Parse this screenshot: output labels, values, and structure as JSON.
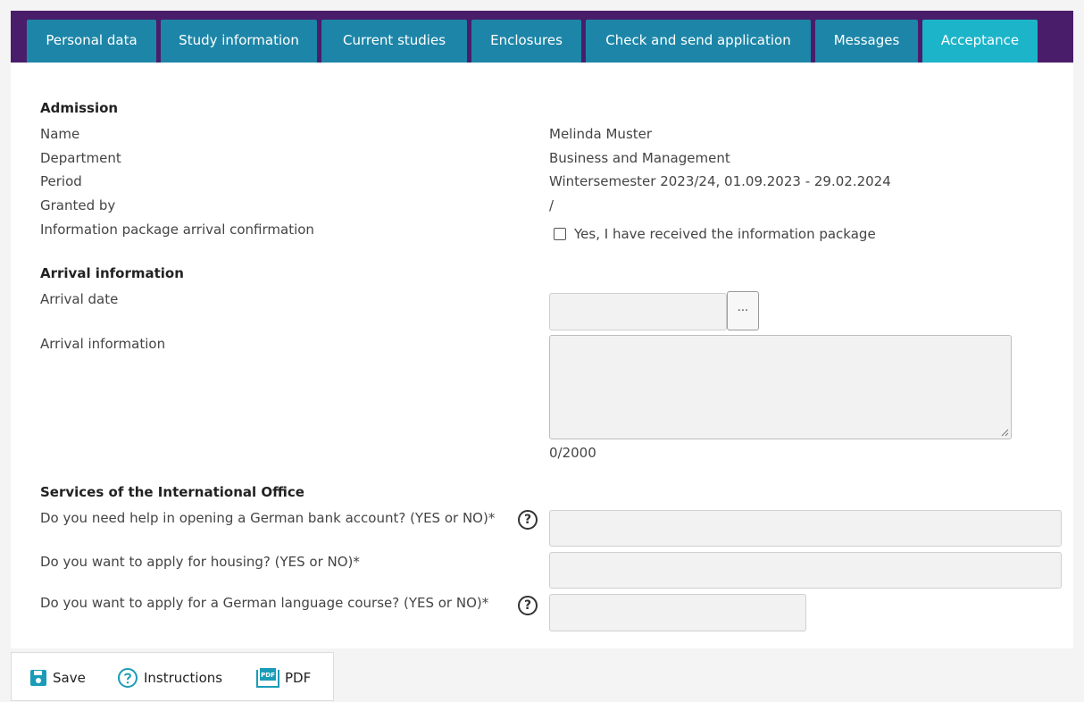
{
  "tabs": [
    {
      "label": "Personal data",
      "active": false
    },
    {
      "label": "Study information",
      "active": false
    },
    {
      "label": "Current studies",
      "active": false
    },
    {
      "label": "Enclosures",
      "active": false
    },
    {
      "label": "Check and send application",
      "active": false
    },
    {
      "label": "Messages",
      "active": false
    },
    {
      "label": "Acceptance",
      "active": true
    }
  ],
  "admission": {
    "title": "Admission",
    "name_label": "Name",
    "name_value": "Melinda Muster",
    "department_label": "Department",
    "department_value": "Business and Management",
    "period_label": "Period",
    "period_value": "Wintersemester 2023/24, 01.09.2023 - 29.02.2024",
    "granted_label": "Granted by",
    "granted_value": "/",
    "package_label": "Information package arrival confirmation",
    "package_checkbox_label": "Yes, I have received the information package",
    "package_checked": false
  },
  "arrival": {
    "title": "Arrival information",
    "date_label": "Arrival date",
    "date_value": "",
    "picker_label": "...",
    "info_label": "Arrival information",
    "info_value": "",
    "char_counter": "0/2000"
  },
  "services": {
    "title": "Services of the International Office",
    "bank_label": "Do you need help in opening a German bank account? (YES or NO)*",
    "bank_value": "",
    "housing_label": "Do you want to apply for housing? (YES or NO)*",
    "housing_value": "",
    "language_label": "Do you want to apply for a German language course? (YES or NO)*",
    "language_value": "",
    "help_glyph": "?"
  },
  "toolbar": {
    "save_label": "Save",
    "instructions_label": "Instructions",
    "pdf_label": "PDF",
    "pdf_badge": "PDF"
  },
  "colors": {
    "tabbar_bg": "#4a1d6a",
    "tab_bg": "#1d86a8",
    "tab_active_bg": "#1cb4c9",
    "icon_accent": "#1a9cb8"
  }
}
